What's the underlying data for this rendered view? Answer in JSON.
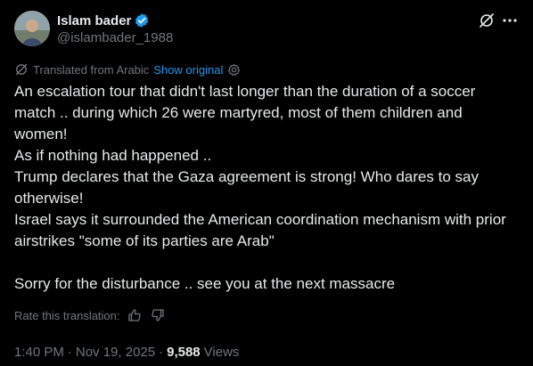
{
  "author": {
    "display_name": "Islam bader",
    "handle": "@islambader_1988",
    "verified": true,
    "verified_color": "#1d9bf0"
  },
  "header_icons": [
    "grok-icon",
    "more-icon"
  ],
  "translation": {
    "label": "Translated from Arabic",
    "show_original": "Show original",
    "icon": "translate-icon",
    "settings_icon": "settings-icon"
  },
  "body": {
    "lines": [
      "An escalation tour that didn't last longer than the duration of a soccer match .. during which 26 were martyred, most of them children and women!",
      "As if nothing had happened ..",
      "Trump declares that the Gaza agreement is strong! Who dares to say otherwise!",
      "Israel says it surrounded the American coordination mechanism with prior airstrikes \"some of its parties are Arab\"",
      "",
      "Sorry for the disturbance .. see you at the next massacre"
    ]
  },
  "rate": {
    "label": "Rate this translation:",
    "icons": [
      "thumbs-up-icon",
      "thumbs-down-icon"
    ]
  },
  "meta": {
    "time": "1:40 PM",
    "date": "Nov 19, 2025",
    "views_count": "9,588",
    "views_label": "Views",
    "separator": "·"
  },
  "colors": {
    "background": "#000000",
    "text": "#e7e9ea",
    "secondary": "#71767b",
    "link": "#1d9bf0"
  }
}
